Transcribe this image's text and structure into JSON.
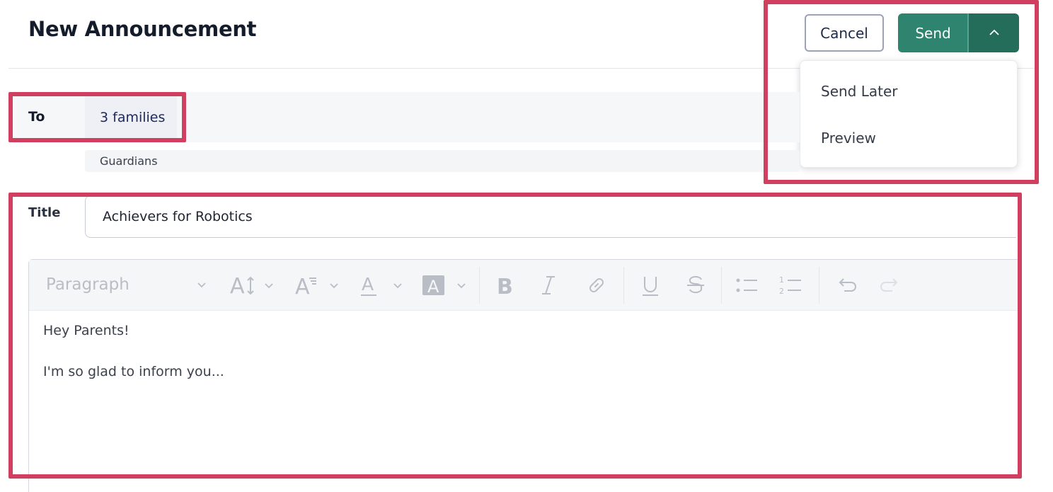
{
  "header": {
    "title": "New Announcement",
    "cancel_label": "Cancel",
    "send_label": "Send"
  },
  "send_menu": {
    "items": [
      {
        "label": "Send Later"
      },
      {
        "label": "Preview"
      }
    ]
  },
  "recipients": {
    "to_label": "To",
    "to_value": "3 families",
    "group": "Guardians"
  },
  "title_field": {
    "label": "Title",
    "value": "Achievers for Robotics"
  },
  "editor": {
    "format_dropdown": "Paragraph",
    "body_lines": [
      "Hey Parents!",
      "I'm so glad to inform you..."
    ],
    "toolbar_icons": [
      "chevron-down-icon",
      "font-size-icon",
      "line-height-icon",
      "font-color-icon",
      "highlight-color-icon",
      "bold-icon",
      "italic-icon",
      "link-icon",
      "underline-icon",
      "strikethrough-icon",
      "bullet-list-icon",
      "numbered-list-icon",
      "undo-icon",
      "redo-icon"
    ]
  },
  "colors": {
    "send_green": "#2f8470",
    "send_split_green": "#236d5a",
    "highlight_red": "#d03f5f"
  }
}
